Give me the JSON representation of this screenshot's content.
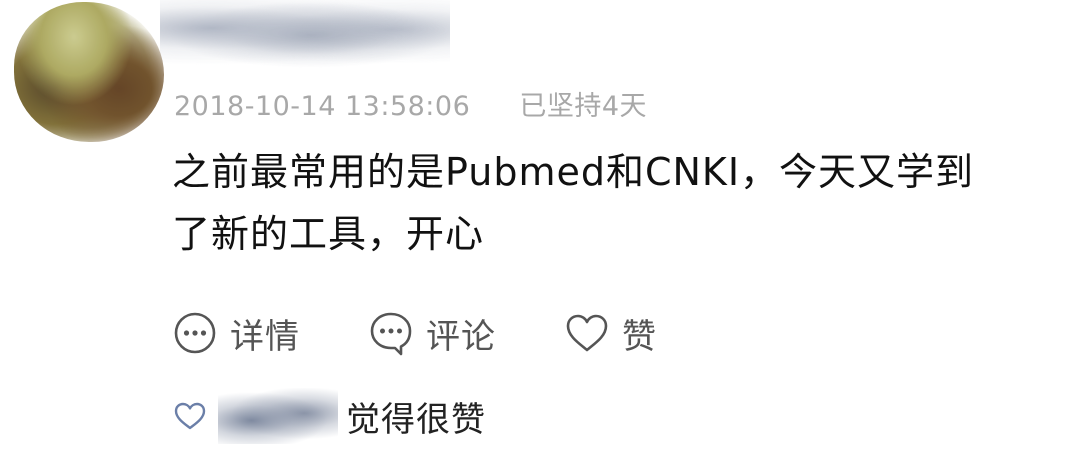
{
  "post": {
    "timestamp": "2018-10-14 13:58:06",
    "streak": "已坚持4天",
    "content": "之前最常用的是Pubmed和CNKI，今天又学到了新的工具，开心"
  },
  "actions": {
    "details_label": "详情",
    "comment_label": "评论",
    "like_label": "赞"
  },
  "likes": {
    "text": "觉得很赞"
  },
  "icons": {
    "details": "more-dots-circle-icon",
    "comment": "comment-bubble-icon",
    "like": "heart-outline-icon",
    "liked_by": "heart-small-outline-icon"
  },
  "colors": {
    "icon_stroke": "#555555",
    "like_heart": "#6b7fa8",
    "meta_text": "#a8a8a8"
  }
}
